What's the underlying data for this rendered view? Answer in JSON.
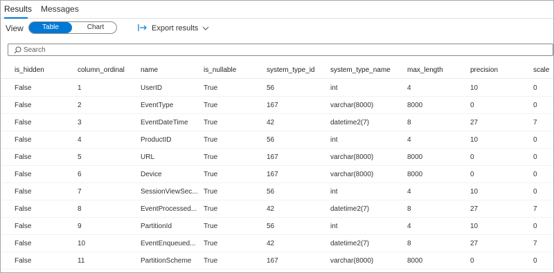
{
  "tabs": [
    {
      "label": "Results",
      "active": true
    },
    {
      "label": "Messages",
      "active": false
    }
  ],
  "view": {
    "label": "View",
    "toggle": {
      "options": [
        "Table",
        "Chart"
      ],
      "selected": "Table"
    },
    "export_label": "Export results",
    "export_icon": "export-arrow-icon",
    "dropdown_icon": "chevron-down-icon"
  },
  "search": {
    "placeholder": "Search",
    "value": "",
    "icon": "search-icon"
  },
  "colors": {
    "accent": "#0078d4",
    "border": "#8a8886",
    "text": "#323130"
  },
  "table": {
    "columns": [
      "is_hidden",
      "column_ordinal",
      "name",
      "is_nullable",
      "system_type_id",
      "system_type_name",
      "max_length",
      "precision",
      "scale"
    ],
    "rows": [
      [
        "False",
        "1",
        "UserID",
        "True",
        "56",
        "int",
        "4",
        "10",
        "0"
      ],
      [
        "False",
        "2",
        "EventType",
        "True",
        "167",
        "varchar(8000)",
        "8000",
        "0",
        "0"
      ],
      [
        "False",
        "3",
        "EventDateTime",
        "True",
        "42",
        "datetime2(7)",
        "8",
        "27",
        "7"
      ],
      [
        "False",
        "4",
        "ProductID",
        "True",
        "56",
        "int",
        "4",
        "10",
        "0"
      ],
      [
        "False",
        "5",
        "URL",
        "True",
        "167",
        "varchar(8000)",
        "8000",
        "0",
        "0"
      ],
      [
        "False",
        "6",
        "Device",
        "True",
        "167",
        "varchar(8000)",
        "8000",
        "0",
        "0"
      ],
      [
        "False",
        "7",
        "SessionViewSec...",
        "True",
        "56",
        "int",
        "4",
        "10",
        "0"
      ],
      [
        "False",
        "8",
        "EventProcessed...",
        "True",
        "42",
        "datetime2(7)",
        "8",
        "27",
        "7"
      ],
      [
        "False",
        "9",
        "PartitionId",
        "True",
        "56",
        "int",
        "4",
        "10",
        "0"
      ],
      [
        "False",
        "10",
        "EventEnqueued...",
        "True",
        "42",
        "datetime2(7)",
        "8",
        "27",
        "7"
      ],
      [
        "False",
        "11",
        "PartitionScheme",
        "True",
        "167",
        "varchar(8000)",
        "8000",
        "0",
        "0"
      ]
    ]
  }
}
